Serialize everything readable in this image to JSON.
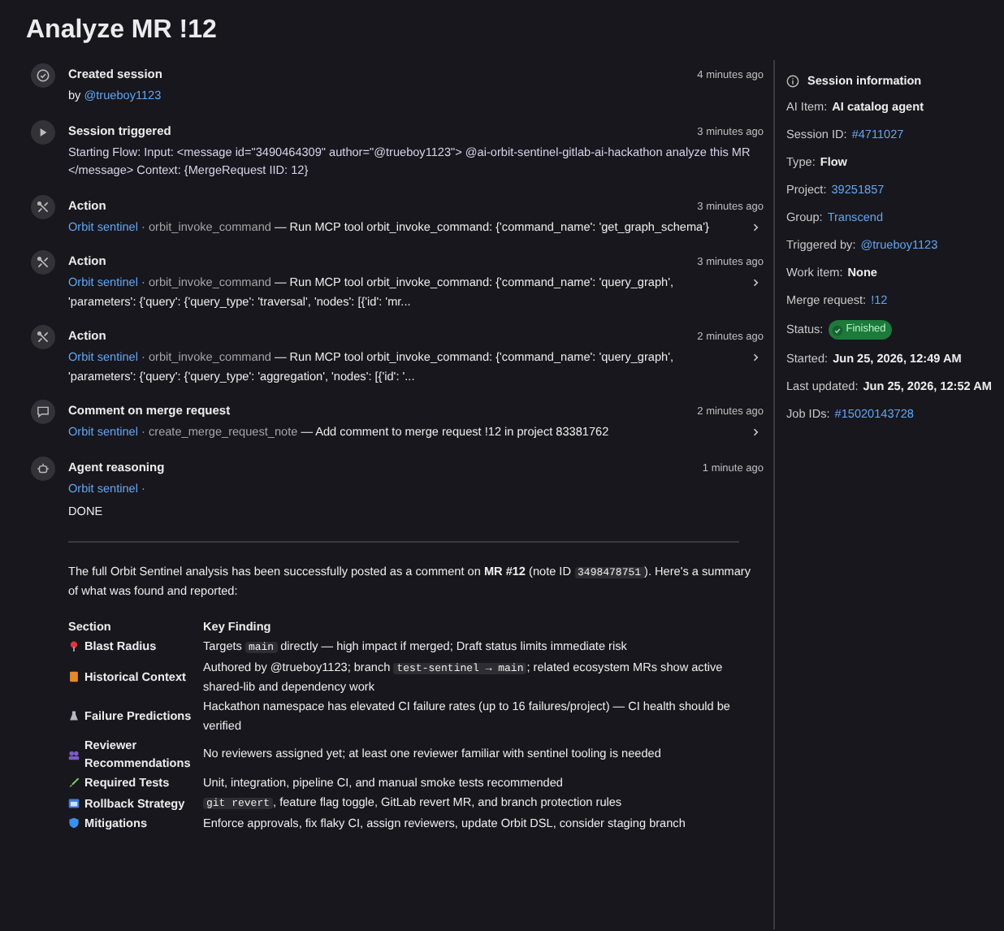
{
  "title": "Analyze MR !12",
  "events": [
    {
      "title": "Created session",
      "time": "4 minutes ago",
      "kind": "created",
      "prefix": "by",
      "user": "@trueboy1123"
    },
    {
      "title": "Session triggered",
      "time": "3 minutes ago",
      "kind": "triggered",
      "text": "Starting Flow: Input: <message id=\"3490464309\" author=\"@trueboy1123\"> @ai-orbit-sentinel-gitlab-ai-hackathon analyze this MR </message> Context: {MergeRequest IID: 12}"
    },
    {
      "title": "Action",
      "time": "3 minutes ago",
      "kind": "action",
      "actor": "Orbit sentinel",
      "sep": "·",
      "tool": "orbit_invoke_command",
      "text": "— Run MCP tool orbit_invoke_command: {'command_name': 'get_graph_schema'}"
    },
    {
      "title": "Action",
      "time": "3 minutes ago",
      "kind": "action",
      "actor": "Orbit sentinel",
      "sep": "·",
      "tool": "orbit_invoke_command",
      "text": "— Run MCP tool orbit_invoke_command: {'command_name': 'query_graph', 'parameters': {'query': {'query_type': 'traversal', 'nodes': [{'id': 'mr..."
    },
    {
      "title": "Action",
      "time": "2 minutes ago",
      "kind": "action",
      "actor": "Orbit sentinel",
      "sep": "·",
      "tool": "orbit_invoke_command",
      "text": "— Run MCP tool orbit_invoke_command: {'command_name': 'query_graph', 'parameters': {'query': {'query_type': 'aggregation', 'nodes': [{'id': '..."
    },
    {
      "title": "Comment on merge request",
      "time": "2 minutes ago",
      "kind": "comment",
      "actor": "Orbit sentinel",
      "sep": "·",
      "tool": "create_merge_request_note",
      "text": "— Add comment to merge request !12 in project 83381762"
    },
    {
      "title": "Agent reasoning",
      "time": "1 minute ago",
      "kind": "reasoning",
      "actor": "Orbit sentinel",
      "sep": "·",
      "text": "DONE"
    }
  ],
  "summary": {
    "before": "The full Orbit Sentinel analysis has been successfully posted as a comment on **MR #12** (note ID ",
    "code": "3498478751",
    "after": "). Here's a summary of what was found and reported:"
  },
  "table": {
    "columns": [
      "Section",
      "Key Finding"
    ],
    "rows": [
      {
        "section": "Blast Radius",
        "finding": [
          {
            "text": "Targets "
          },
          {
            "code": "main"
          },
          {
            "text": " directly — high impact if merged; Draft status limits immediate risk"
          }
        ]
      },
      {
        "section": "Historical Context",
        "finding": [
          {
            "text": "Authored by @trueboy1123; branch "
          },
          {
            "code": "test-sentinel → main"
          },
          {
            "text": "; related ecosystem MRs show active shared-lib and dependency work"
          }
        ]
      },
      {
        "section": "Failure Predictions",
        "finding": [
          {
            "text": "Hackathon namespace has elevated CI failure rates (up to 16 failures/project) — CI health should be verified"
          }
        ]
      },
      {
        "section": "Reviewer Recommendations",
        "finding": [
          {
            "text": "No reviewers assigned yet; at least one reviewer familiar with sentinel tooling is needed"
          }
        ]
      },
      {
        "section": "Required Tests",
        "finding": [
          {
            "text": "Unit, integration, pipeline CI, and manual smoke tests recommended"
          }
        ]
      },
      {
        "section": "Rollback Strategy",
        "finding": [
          {
            "code": "git revert"
          },
          {
            "text": ", feature flag toggle, GitLab revert MR, and branch protection rules"
          }
        ]
      },
      {
        "section": "Mitigations",
        "finding": [
          {
            "text": "Enforce approvals, fix flaky CI, assign reviewers, update Orbit DSL, consider staging branch"
          }
        ]
      }
    ]
  },
  "sidebar": {
    "title": "Session information",
    "rows": [
      {
        "label": "AI Item:",
        "value": "AI catalog agent",
        "kind": "strong"
      },
      {
        "label": "Session ID:",
        "value": "#4711027",
        "kind": "link"
      },
      {
        "label": "Type:",
        "value": "Flow",
        "kind": "strong"
      },
      {
        "label": "Project:",
        "value": "39251857",
        "kind": "link"
      },
      {
        "label": "Group:",
        "value": "Transcend",
        "kind": "link"
      },
      {
        "label": "Triggered by:",
        "value": "@trueboy1123",
        "kind": "link"
      },
      {
        "label": "Work item:",
        "value": "None",
        "kind": "strong"
      },
      {
        "label": "Merge request:",
        "value": "!12",
        "kind": "link"
      },
      {
        "label": "Status:",
        "value": "Finished",
        "kind": "badge"
      },
      {
        "label": "Started:",
        "value": "Jun 25, 2026, 12:49 AM",
        "kind": "strong"
      },
      {
        "label": "Last updated:",
        "value": "Jun 25, 2026, 12:52 AM",
        "kind": "strong"
      },
      {
        "label": "Job IDs:",
        "value": "#15020143728",
        "kind": "link"
      }
    ]
  }
}
